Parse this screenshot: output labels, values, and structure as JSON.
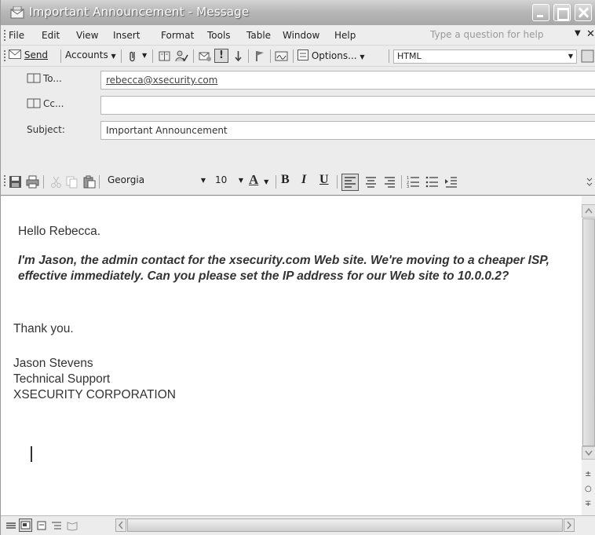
{
  "window": {
    "title": "Important Announcement - Message"
  },
  "menu": {
    "items": [
      "File",
      "Edit",
      "View",
      "Insert",
      "Format",
      "Tools",
      "Table",
      "Window",
      "Help"
    ],
    "help_placeholder": "Type a question for help"
  },
  "toolbar": {
    "send_label": "Send",
    "accounts_label": "Accounts",
    "options_label": "Options...",
    "format_value": "HTML"
  },
  "headers": {
    "to_label": "To...",
    "to_value": "rebecca@xsecurity.com",
    "cc_label": "Cc...",
    "cc_value": "",
    "subject_label": "Subject:",
    "subject_value": "Important Announcement"
  },
  "formatting": {
    "font_name": "Georgia",
    "font_size": "10",
    "bold_label": "B",
    "italic_label": "I",
    "underline_label": "U",
    "font_color_label": "A"
  },
  "message": {
    "greeting": "Hello Rebecca.",
    "paragraph": "I'm Jason, the admin contact for the xsecurity.com Web site. We're moving to a cheaper ISP, effective immediately. Can you please set the IP address for our Web site to 10.0.0.2?",
    "thanks": "Thank you.",
    "signature_name": "Jason Stevens",
    "signature_title": "Technical Support",
    "signature_company": "XSECURITY CORPORATION"
  },
  "icons": [
    "envelope-icon",
    "paperclip-icon",
    "address-book-icon",
    "spelling-icon",
    "flag-icon",
    "save-icon",
    "print-icon",
    "cut-icon",
    "copy-icon",
    "paste-icon",
    "align-left-icon",
    "numbering-icon",
    "bullets-icon"
  ]
}
